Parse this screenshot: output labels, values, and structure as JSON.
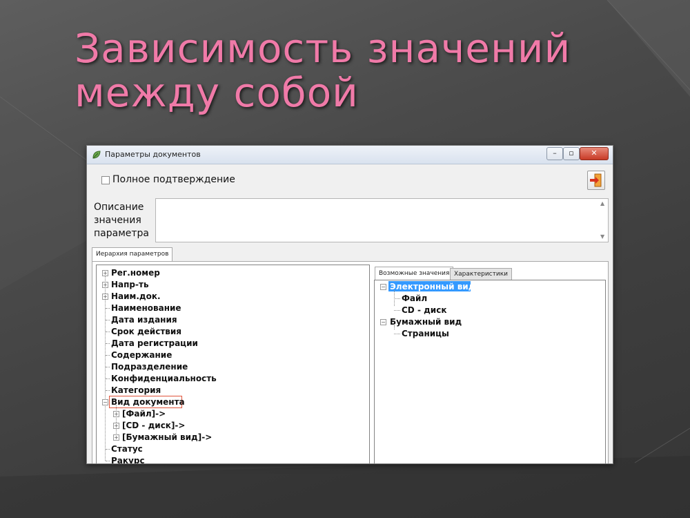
{
  "slide": {
    "title_line1": "Зависимость значений",
    "title_line2": "между собой",
    "title_color": "#f07aa8"
  },
  "window": {
    "title": "Параметры документов",
    "icon": "app-leaf-icon",
    "buttons": {
      "minimize": "minimize-icon",
      "maximize": "maximize-icon",
      "close": "close-icon"
    }
  },
  "top_panel": {
    "confirm_label": "Полное подтверждение",
    "confirm_checked": false,
    "exit_icon": "exit-door-icon"
  },
  "description": {
    "label_line1": "Описание",
    "label_line2": "значения",
    "label_line3": "параметра",
    "value": ""
  },
  "tabs": {
    "hierarchy": "Иерархия параметров",
    "values": "Возможные значения",
    "characteristics": "Характеристики"
  },
  "left_tree": [
    {
      "label": "Рег.номер",
      "expandable": true
    },
    {
      "label": "Напр-ть",
      "expandable": true
    },
    {
      "label": "Наим.док.",
      "expandable": true
    },
    {
      "label": "Наименование",
      "expandable": false
    },
    {
      "label": "Дата издания",
      "expandable": false
    },
    {
      "label": "Срок действия",
      "expandable": false
    },
    {
      "label": "Дата регистрации",
      "expandable": false
    },
    {
      "label": "Содержание",
      "expandable": false
    },
    {
      "label": "Подразделение",
      "expandable": false
    },
    {
      "label": "Конфиденциальность",
      "expandable": false
    },
    {
      "label": "Категория",
      "expandable": false
    },
    {
      "label": "Вид документа",
      "expandable": true,
      "expanded": true,
      "highlighted": true,
      "children": [
        "[Файл]->",
        "[CD - диск]->",
        "[Бумажный вид]->"
      ]
    },
    {
      "label": "Статус",
      "expandable": false
    },
    {
      "label": "Ракурс",
      "expandable": false
    }
  ],
  "right_tree": [
    {
      "label": "Электронный вид",
      "selected": true,
      "children": [
        "Файл",
        "CD - диск"
      ]
    },
    {
      "label": "Бумажный вид",
      "selected": false,
      "children": [
        "Страницы"
      ]
    }
  ],
  "colors": {
    "highlight_border": "#e0533a",
    "selection": "#3399ff"
  }
}
